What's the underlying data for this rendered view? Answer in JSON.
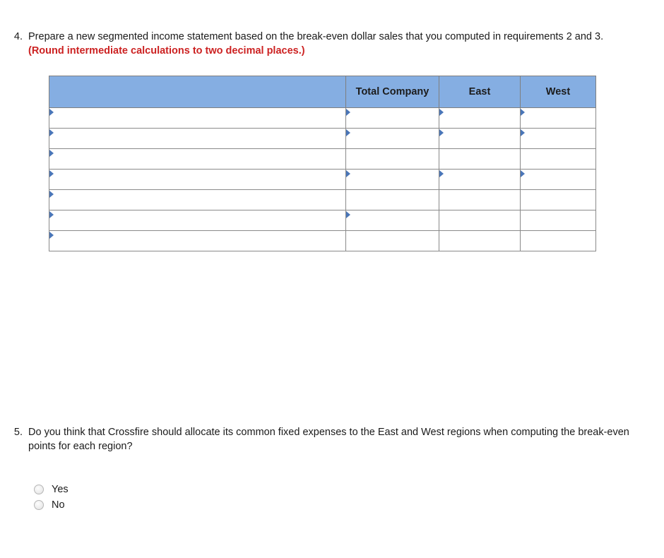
{
  "question4": {
    "number": "4.",
    "text": "Prepare a new segmented income statement based on the break-even dollar sales that you computed in requirements 2 and 3. ",
    "emphasis": "(Round intermediate calculations to two decimal places.)"
  },
  "question5": {
    "number": "5.",
    "text": "Do you think that Crossfire should allocate its common fixed expenses to the East and West regions when computing the break-even points for each region?",
    "options": [
      {
        "label": "Yes",
        "selected": false
      },
      {
        "label": "No",
        "selected": false
      }
    ]
  },
  "table": {
    "headers": {
      "label": "",
      "total_company": "Total Company",
      "east": "East",
      "west": "West"
    },
    "header_background": "#85aee2",
    "rows": [
      {
        "label": "",
        "total_company": "",
        "east": "",
        "west": ""
      },
      {
        "label": "",
        "total_company": "",
        "east": "",
        "west": ""
      },
      {
        "label": "",
        "total_company": "",
        "east": "",
        "west": ""
      },
      {
        "label": "",
        "total_company": "",
        "east": "",
        "west": ""
      },
      {
        "label": "",
        "total_company": "",
        "east": "",
        "west": ""
      },
      {
        "label": "",
        "total_company": "",
        "east": "",
        "west": ""
      },
      {
        "label": "",
        "total_company": "",
        "east": "",
        "west": ""
      }
    ]
  },
  "colors": {
    "header_blue": "#85aee2",
    "emphasis_red": "#cc2222",
    "input_marker_blue": "#4a76b8",
    "rule_black": "#000000"
  }
}
